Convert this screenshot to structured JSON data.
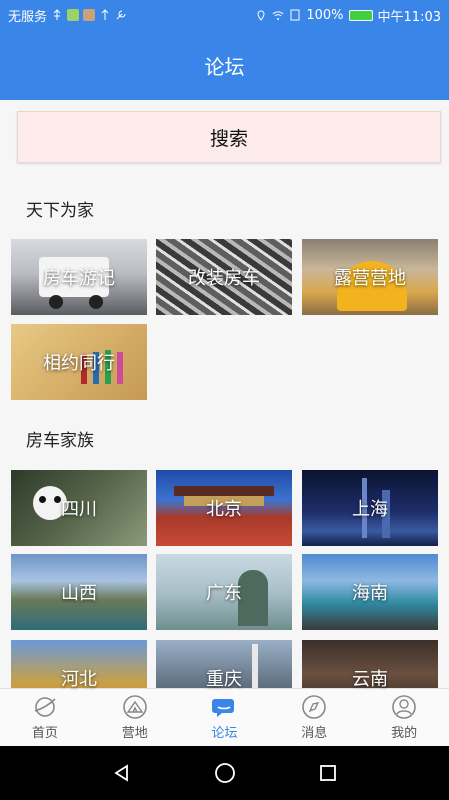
{
  "status_bar": {
    "carrier": "无服务",
    "battery": "100%",
    "time": "中午11:03"
  },
  "header": {
    "title": "论坛"
  },
  "search": {
    "label": "搜索"
  },
  "sections": [
    {
      "title": "天下为家",
      "tiles": [
        {
          "label": "房车游记"
        },
        {
          "label": "改装房车"
        },
        {
          "label": "露营营地"
        },
        {
          "label": "相约同行"
        }
      ]
    },
    {
      "title": "房车家族",
      "tiles": [
        {
          "label": "四川"
        },
        {
          "label": "北京"
        },
        {
          "label": "上海"
        },
        {
          "label": "山西"
        },
        {
          "label": "广东"
        },
        {
          "label": "海南"
        },
        {
          "label": "河北"
        },
        {
          "label": "重庆"
        },
        {
          "label": "云南"
        }
      ]
    }
  ],
  "tab_bar": {
    "items": [
      {
        "label": "首页",
        "icon": "planet-icon"
      },
      {
        "label": "营地",
        "icon": "tent-icon"
      },
      {
        "label": "论坛",
        "icon": "chat-bubble-icon",
        "active": true
      },
      {
        "label": "消息",
        "icon": "compass-icon"
      },
      {
        "label": "我的",
        "icon": "user-icon"
      }
    ]
  },
  "colors": {
    "primary": "#3a86e8",
    "search_bg": "#fdebeb"
  }
}
